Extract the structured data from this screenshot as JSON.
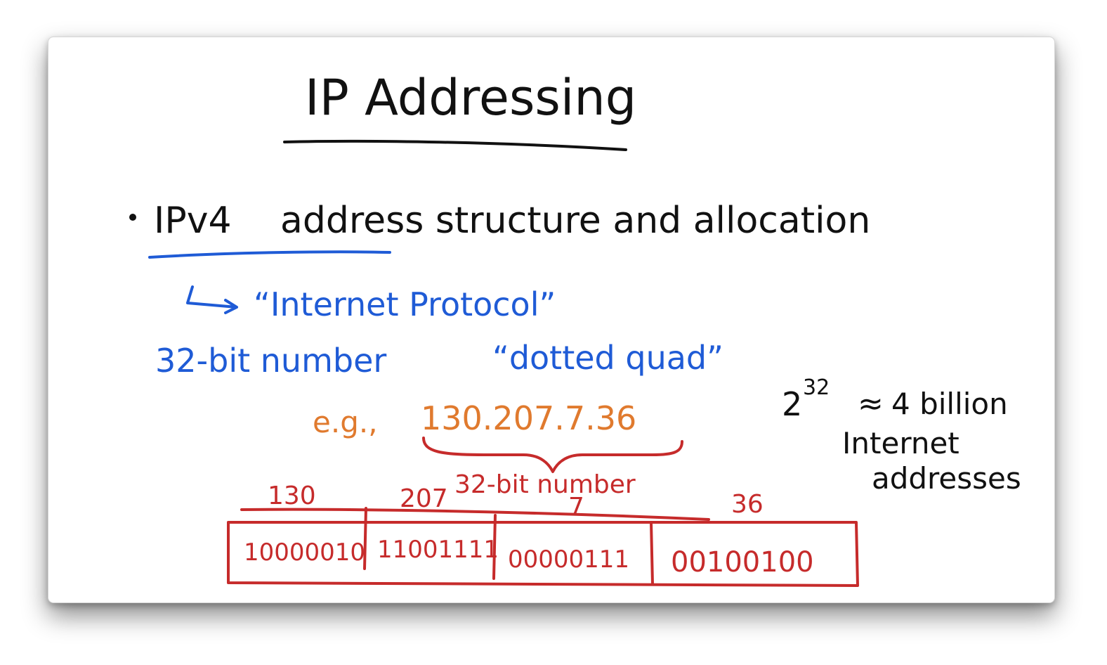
{
  "title": "IP Addressing",
  "bullet": {
    "topic_prefix": "IPv4",
    "topic_rest": "address structure and allocation",
    "expansion": "“Internet Protocol”"
  },
  "format": {
    "bits": "32-bit number",
    "notation": "“dotted quad”",
    "example_prefix": "e.g.,",
    "example_address": "130.207.7.36",
    "brace_label": "32-bit number"
  },
  "octets": [
    {
      "decimal": "130",
      "binary": "10000010"
    },
    {
      "decimal": "207",
      "binary": "11001111"
    },
    {
      "decimal": "7",
      "binary": "00000111"
    },
    {
      "decimal": "36",
      "binary": "00100100"
    }
  ],
  "capacity": {
    "base": "2",
    "exponent": "32",
    "approx": "≈",
    "amount": "4 billion",
    "line1": "Internet",
    "line2": "addresses"
  },
  "colors": {
    "black_ink": "#111111",
    "blue_ink": "#1f5bd6",
    "orange_ink": "#e07a2e",
    "red_ink": "#c62b2b"
  }
}
